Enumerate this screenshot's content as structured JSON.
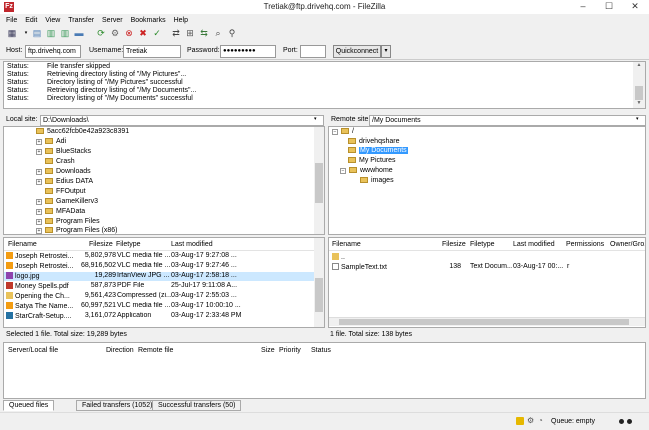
{
  "window": {
    "title": "Tretiak@ftp.drivehq.com - FileZilla",
    "app_icon": "Fz"
  },
  "menu": [
    "File",
    "Edit",
    "View",
    "Transfer",
    "Server",
    "Bookmarks",
    "Help"
  ],
  "quickconnect": {
    "host_label": "Host:",
    "host_value": "ftp.drivehq.com",
    "user_label": "Username:",
    "user_value": "Tretiak",
    "pass_label": "Password:",
    "pass_value": "●●●●●●●●●",
    "port_label": "Port:",
    "port_value": "",
    "button": "Quickconnect",
    "arrow": "▾"
  },
  "log": [
    {
      "label": "Status:",
      "msg": "File transfer skipped"
    },
    {
      "label": "Status:",
      "msg": "Retrieving directory listing of \"/My Pictures\"..."
    },
    {
      "label": "Status:",
      "msg": "Directory listing of \"/My Pictures\" successful"
    },
    {
      "label": "Status:",
      "msg": "Retrieving directory listing of \"/My Documents\"..."
    },
    {
      "label": "Status:",
      "msg": "Directory listing of \"/My Documents\" successful"
    }
  ],
  "local": {
    "site_label": "Local site:",
    "site_path": "D:\\Downloads\\",
    "tree": [
      "5acc62fcb0e42a923c8391",
      "Adi",
      "BlueStacks",
      "Crash",
      "Downloads",
      "Edius DATA",
      "FFOutput",
      "GameKillerv3",
      "MFAData",
      "Program Files",
      "Program Files (x86)"
    ],
    "columns": [
      "Filename",
      "Filesize",
      "Filetype",
      "Last modified"
    ],
    "files": [
      {
        "name": "Joseph Retrostei...",
        "size": "5,802,978",
        "type": "VLC media file ...",
        "mod": "03-Aug-17 9:27:08 ..."
      },
      {
        "name": "Joseph Retrostei...",
        "size": "68,916,502",
        "type": "VLC media file ...",
        "mod": "03-Aug-17 9:27:46 ..."
      },
      {
        "name": "logo.jpg",
        "size": "19,289",
        "type": "IrfanView JPG ...",
        "mod": "03-Aug-17 2:58:18 ..."
      },
      {
        "name": "Money Spells.pdf",
        "size": "587,873",
        "type": "PDF File",
        "mod": "25-Jul-17 9:11:08 A..."
      },
      {
        "name": "Opening the Ch...",
        "size": "9,561,423",
        "type": "Compressed (zi...",
        "mod": "03-Aug-17 2:55:03 ..."
      },
      {
        "name": "Satya The Name...",
        "size": "60,997,521",
        "type": "VLC media file ...",
        "mod": "03-Aug-17 10:00:10 ..."
      },
      {
        "name": "StarCraft-Setup....",
        "size": "3,161,072",
        "type": "Application",
        "mod": "03-Aug-17 2:33:48 PM"
      }
    ],
    "status": "Selected 1 file. Total size: 19,289 bytes"
  },
  "remote": {
    "site_label": "Remote site:",
    "site_path": "/My Documents",
    "tree": [
      "/",
      "drivehqshare",
      "My Documents",
      "My Pictures",
      "wwwhome",
      "images"
    ],
    "columns": [
      "Filename",
      "Filesize",
      "Filetype",
      "Last modified",
      "Permissions",
      "Owner/Gro..."
    ],
    "files": [
      {
        "name": "..",
        "size": "",
        "type": "",
        "mod": "",
        "perm": ""
      },
      {
        "name": "SampleText.txt",
        "size": "138",
        "type": "Text Docum...",
        "mod": "03-Aug-17 00:...",
        "perm": "r"
      }
    ],
    "status": "1 file. Total size: 138 bytes"
  },
  "queue": {
    "columns": [
      "Server/Local file",
      "Direction",
      "Remote file",
      "Size",
      "Priority",
      "Status"
    ]
  },
  "tabs": [
    "Queued files",
    "Failed transfers (1052)",
    "Successful transfers (50)"
  ],
  "statusbar": {
    "queue": "Queue: empty"
  }
}
